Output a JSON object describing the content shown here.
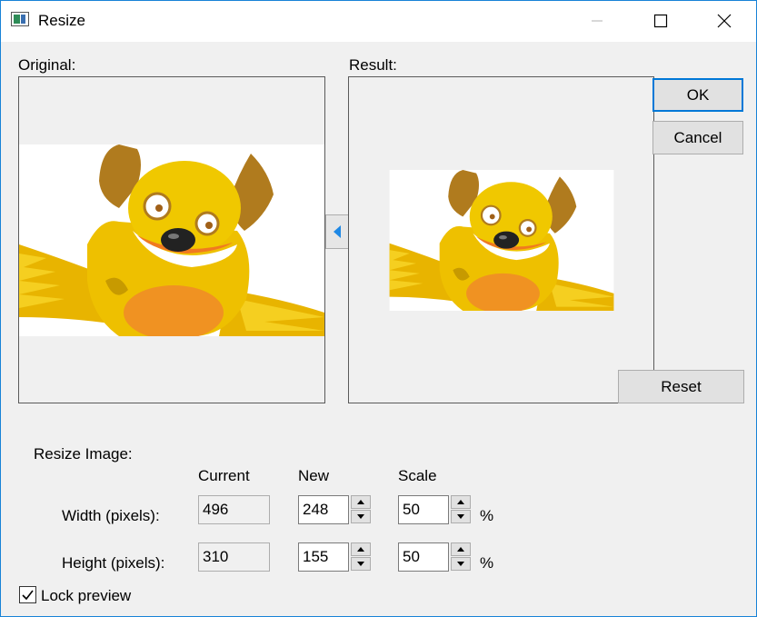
{
  "window": {
    "title": "Resize"
  },
  "preview": {
    "original_label": "Original:",
    "result_label": "Result:"
  },
  "buttons": {
    "ok": "OK",
    "cancel": "Cancel",
    "reset": "Reset"
  },
  "resize": {
    "section_label": "Resize Image:",
    "col_current": "Current",
    "col_new": "New",
    "col_scale": "Scale",
    "width_label": "Width (pixels):",
    "height_label": "Height (pixels):",
    "width_current": "496",
    "width_new": "248",
    "width_scale": "50",
    "height_current": "310",
    "height_new": "155",
    "height_scale": "50",
    "percent": "%"
  },
  "lock_preview": {
    "label": "Lock preview",
    "checked": true
  },
  "colors": {
    "accent": "#0078d7",
    "arrow": "#1e88e5"
  }
}
